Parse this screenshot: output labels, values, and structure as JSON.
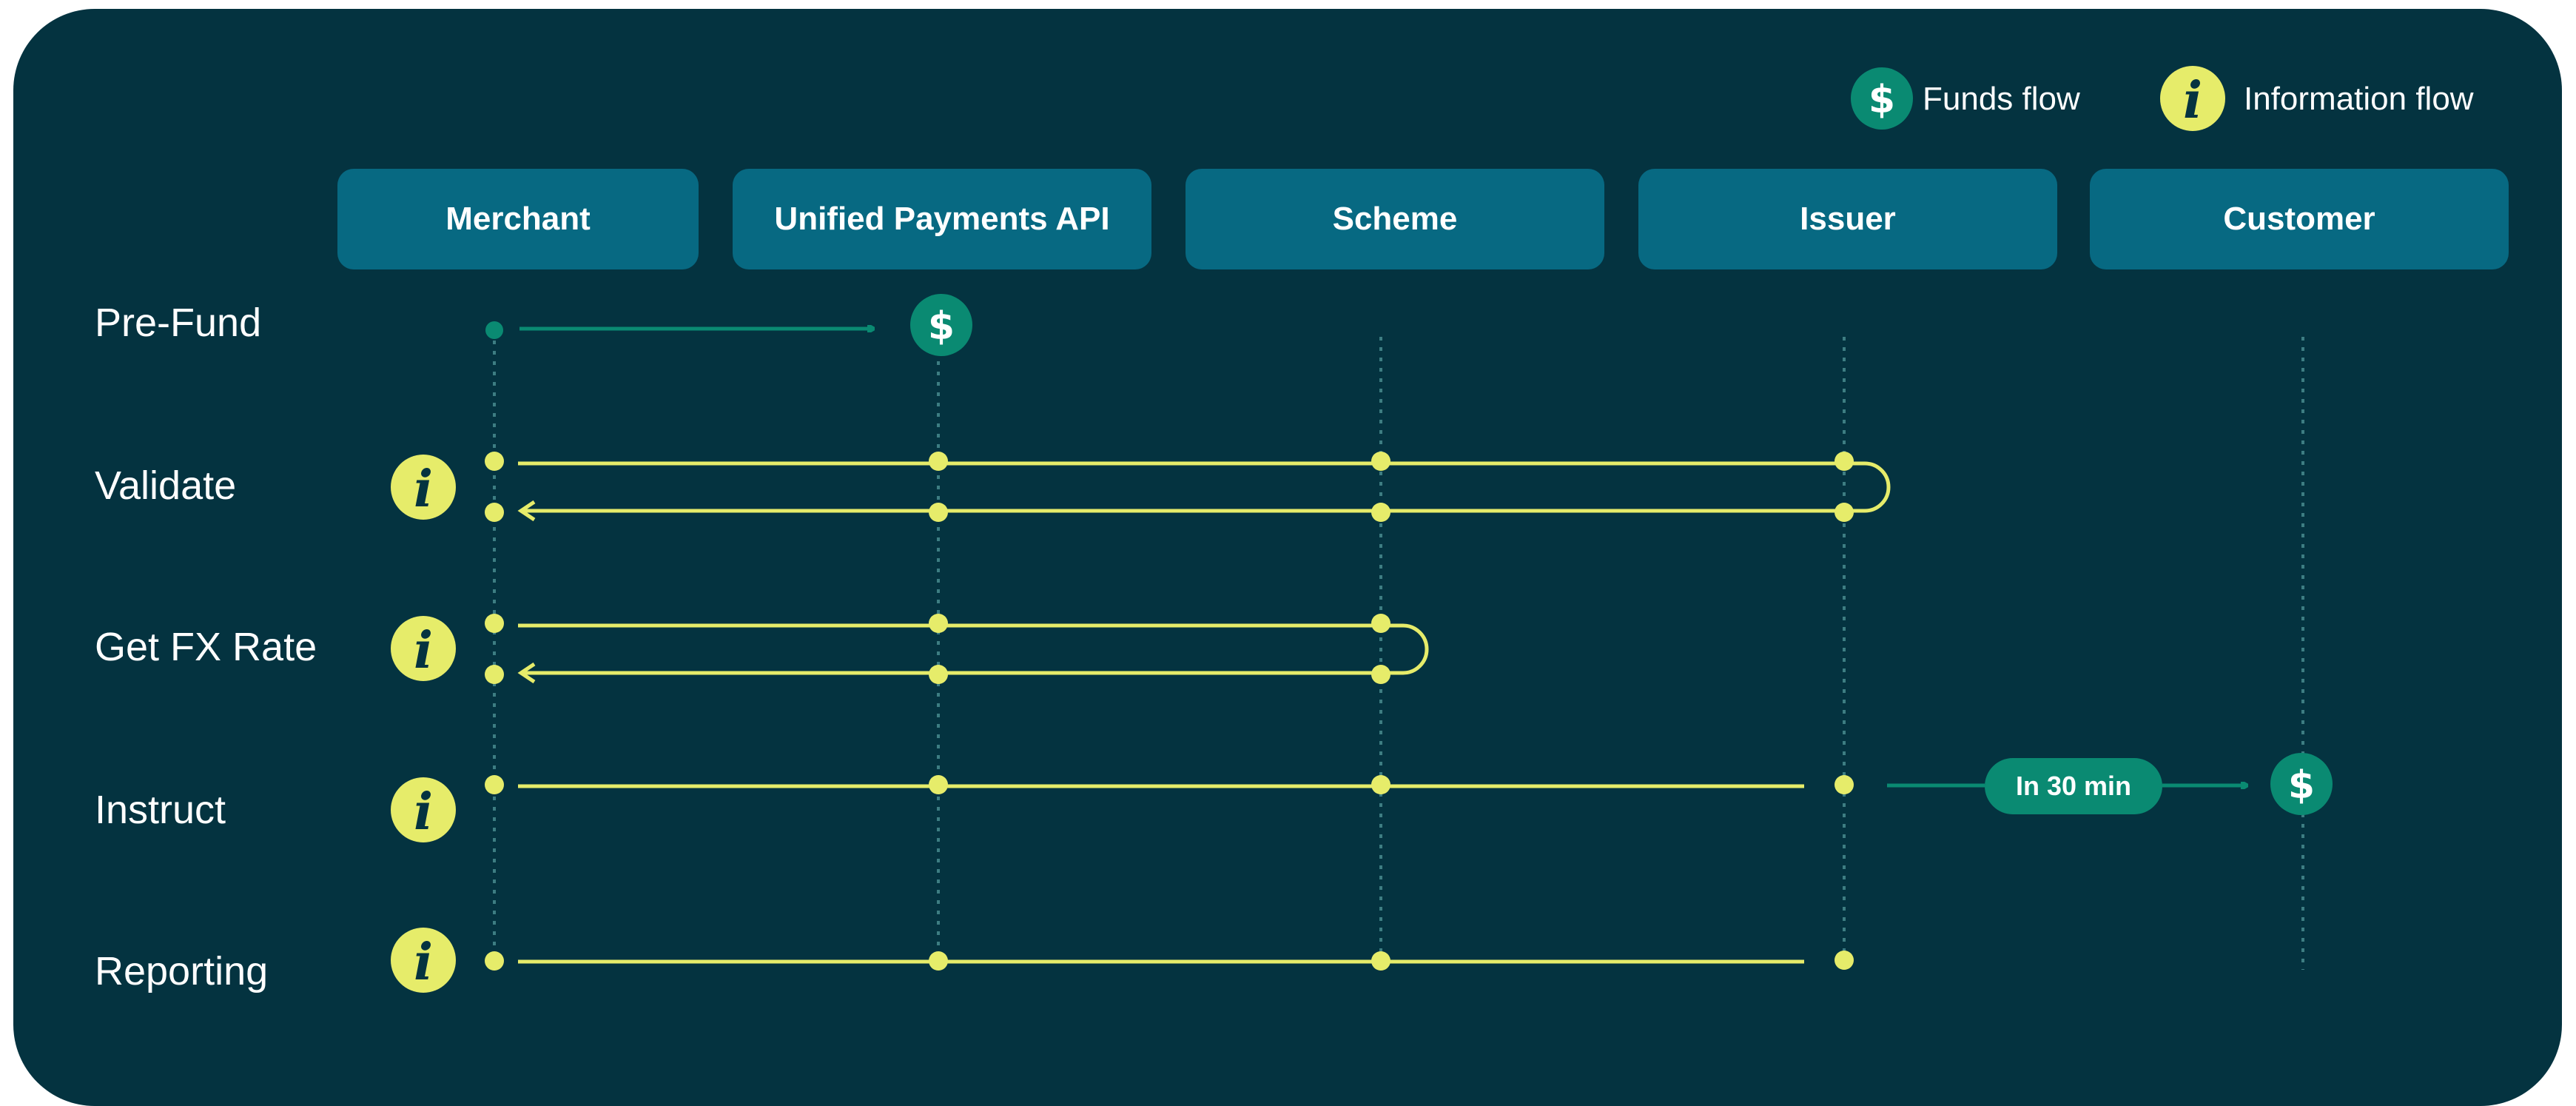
{
  "legend": [
    {
      "label": "Funds flow",
      "icon": "dollar-icon"
    },
    {
      "label": "Information flow",
      "icon": "info-icon"
    }
  ],
  "participants": [
    "Merchant",
    "Unified Payments API",
    "Scheme",
    "Issuer",
    "Customer"
  ],
  "steps": [
    {
      "label": "Pre-Fund",
      "flow": "funds",
      "from": "Merchant",
      "to": "Unified Payments API"
    },
    {
      "label": "Validate",
      "flow": "information",
      "from": "Merchant",
      "to": "Issuer",
      "round_trip": true
    },
    {
      "label": "Get FX Rate",
      "flow": "information",
      "from": "Merchant",
      "to": "Scheme",
      "round_trip": true
    },
    {
      "label": "Instruct",
      "flow": "information",
      "from": "Merchant",
      "to": "Issuer",
      "then": {
        "flow": "funds",
        "to": "Customer",
        "note": "In 30 min"
      }
    },
    {
      "label": "Reporting",
      "flow": "information",
      "from": "Merchant",
      "to": "Issuer"
    }
  ],
  "colors": {
    "background": "#043340",
    "header": "#076982",
    "funds": "#0a8a72",
    "information": "#e6ec6a",
    "lifeline": "#3d7d82",
    "text": "#ffffff"
  },
  "icons": {
    "dollar": "$",
    "info": "i"
  }
}
